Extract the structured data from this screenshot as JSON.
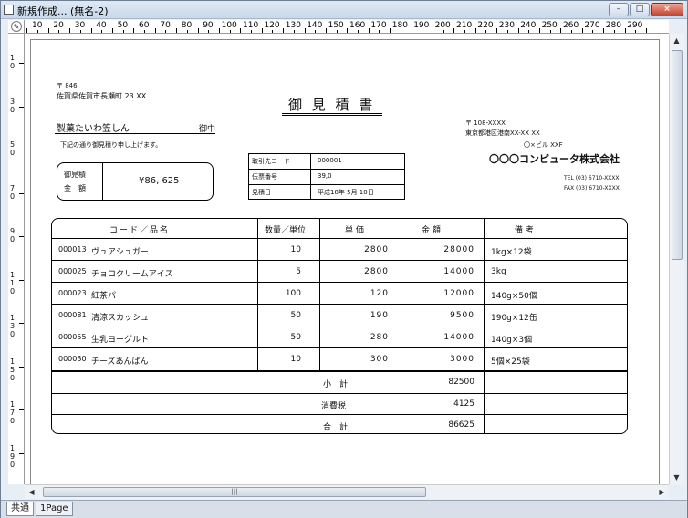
{
  "window": {
    "title": "新規作成... (無名-2)",
    "buttons": {
      "minimize": "–",
      "maximize": "□",
      "close": "×"
    }
  },
  "ruler": {
    "h_labels": [
      "10",
      "20",
      "30",
      "40",
      "50",
      "60",
      "70",
      "80",
      "90",
      "100",
      "110",
      "120",
      "130",
      "140",
      "150",
      "160",
      "170",
      "180",
      "190",
      "200",
      "210",
      "220",
      "230",
      "240",
      "250",
      "260",
      "270",
      "280",
      "290"
    ],
    "v_labels": [
      "1\n0",
      "3\n0",
      "5\n0",
      "7\n0",
      "9\n0",
      "1\n1\n0",
      "1\n3\n0",
      "1\n5\n0",
      "1\n7\n0",
      "1\n9\n0"
    ]
  },
  "tabs": [
    {
      "label": "共通"
    },
    {
      "label": "1Page"
    }
  ],
  "document": {
    "postal": "〒 846",
    "address": "佐賀県佐賀市長瀬町 23 XX",
    "title": "御 見 積 書",
    "customer": "製菓たいわ笠しん",
    "honorific": "御中",
    "intro": "下記の通り御見積り申し上げます。",
    "total_label_1": "御見積",
    "total_label_2": "金　額",
    "total_amount": "¥86, 625",
    "info": [
      {
        "label": "取引先コード",
        "value": "000001"
      },
      {
        "label": "伝票番号",
        "value": "39,0"
      },
      {
        "label": "見積日",
        "value": "平成18年 5月 10日"
      }
    ],
    "company": {
      "postal": "〒 108-XXXX",
      "address": "東京都港区港南XX-XX XX",
      "building": "〇×ビル XXF",
      "name": "〇〇〇コンピュータ株式会社",
      "tel": "TEL (03) 6710-XXXX",
      "fax": "FAX (03) 6710-XXXX"
    },
    "table": {
      "headers": [
        "コード／品名",
        "数量／単位",
        "単 価",
        "金 額",
        "備 考"
      ],
      "rows": [
        {
          "code": "000013",
          "name": "ヴュアシュガー",
          "qty": "10",
          "price": "2800",
          "amount": "28000",
          "note": "1kg×12袋"
        },
        {
          "code": "000025",
          "name": "チョコクリームアイス",
          "qty": "5",
          "price": "2800",
          "amount": "14000",
          "note": "3kg"
        },
        {
          "code": "000023",
          "name": "紅茶パー",
          "qty": "100",
          "price": "120",
          "amount": "12000",
          "note": "140g×50個"
        },
        {
          "code": "000081",
          "name": "清涼スカッシュ",
          "qty": "50",
          "price": "190",
          "amount": "9500",
          "note": "190g×12缶"
        },
        {
          "code": "000055",
          "name": "生乳ヨーグルト",
          "qty": "50",
          "price": "280",
          "amount": "14000",
          "note": "140g×3個"
        },
        {
          "code": "000030",
          "name": "チーズあんぱん",
          "qty": "10",
          "price": "300",
          "amount": "3000",
          "note": "5個×25袋"
        }
      ],
      "subtotal_label": "小　計",
      "subtotal": "82500",
      "tax_label": "消費税",
      "tax": "4125",
      "total_label": "合　計",
      "total": "86625"
    }
  }
}
